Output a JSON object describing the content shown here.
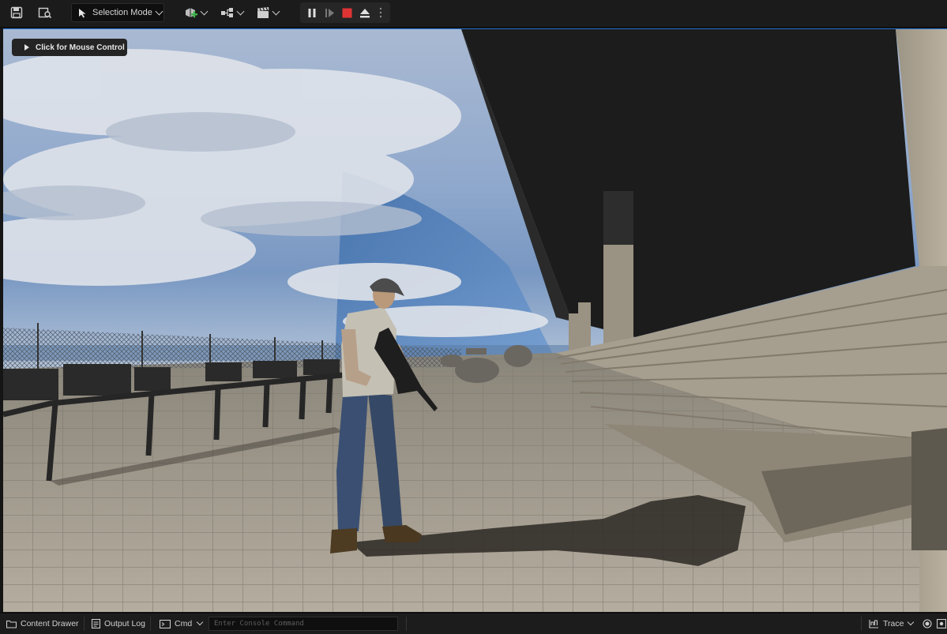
{
  "toolbar": {
    "save_icon": "save-icon",
    "browse_icon": "browse-level-icon",
    "mode_label": "Selection Mode",
    "add_actor_icon": "add-actor-icon",
    "blueprint_icon": "blueprint-icon",
    "cinematics_icon": "cinematics-icon",
    "play_controls": [
      "pause-icon",
      "frame-step-icon",
      "stop-icon",
      "eject-icon",
      "more-options-icon"
    ]
  },
  "viewport": {
    "mouse_control_label": "Click for Mouse Control"
  },
  "statusbar": {
    "content_drawer_label": "Content Drawer",
    "output_log_label": "Output Log",
    "cmd_label": "Cmd",
    "console_placeholder": "Enter Console Command",
    "trace_label": "Trace"
  },
  "colors": {
    "accent": "#1e6fd0",
    "stop": "#e03434",
    "toolbar_bg": "#1b1b1b"
  }
}
